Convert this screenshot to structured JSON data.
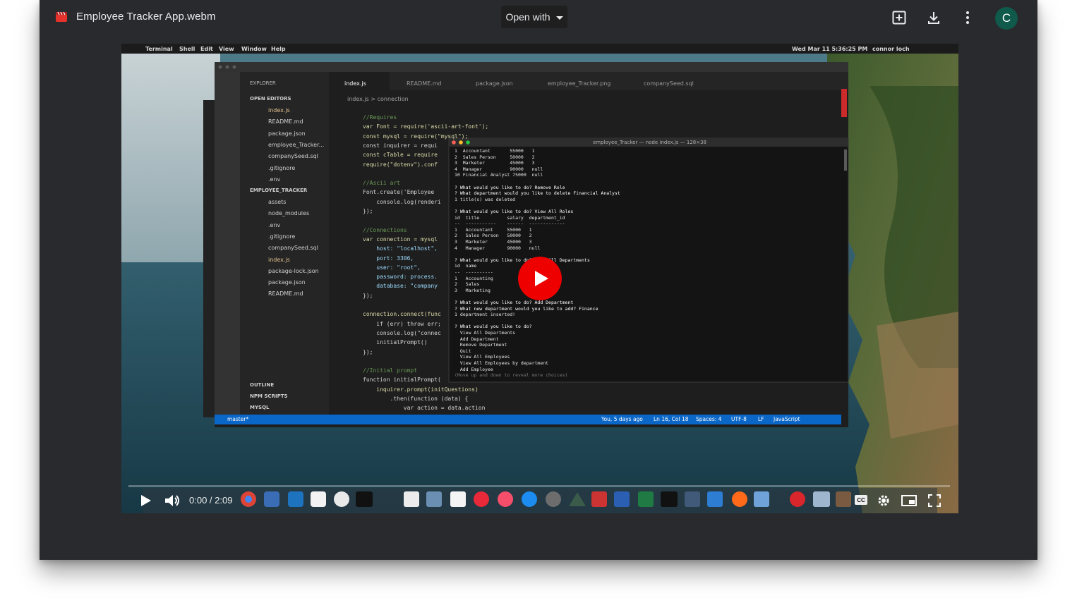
{
  "header": {
    "file_name": "Employee Tracker App.webm",
    "open_with_label": "Open with",
    "avatar_letter": "C"
  },
  "video": {
    "mac_menu": [
      "Terminal",
      "Shell",
      "Edit",
      "View",
      "Window",
      "Help"
    ],
    "clock": "Wed Mar 11 5:36:25 PM",
    "user": "connor loch",
    "editor_tabs": [
      "index.js",
      "README.md",
      "package.json",
      "employee_Tracker.png",
      "companySeed.sql"
    ],
    "breadcrumb": "index.js > connection",
    "explorer": {
      "title": "EXPLORER",
      "open_editors": "OPEN EDITORS",
      "open_files": [
        "index.js",
        "README.md",
        "package.json",
        "employee_Tracker...",
        "companySeed.sql",
        ".gitignore",
        ".env"
      ],
      "project": "EMPLOYEE_TRACKER",
      "project_files": [
        "assets",
        "node_modules",
        ".env",
        ".gitignore",
        "companySeed.sql",
        "index.js",
        "package-lock.json",
        "package.json",
        "README.md"
      ],
      "bottom_sections": [
        "OUTLINE",
        "NPM SCRIPTS",
        "MYSQL"
      ]
    },
    "code_lines": [
      "//Requires",
      "var Font = require('ascii-art-font');",
      "const mysql = require(\"mysql\");",
      "const inquirer = requi",
      "const cTable = require",
      "require(\"dotenv\").conf",
      "",
      "//Ascii art",
      "Font.create('Employee",
      "    console.log(renderi",
      "});",
      "",
      "//Connections",
      "var connection = mysql",
      "    host: \"localhost\",",
      "    port: 3306,",
      "    user: \"root\",",
      "    password: process.",
      "    database: \"company",
      "});",
      "",
      "connection.connect(func",
      "    if (err) throw err;",
      "    console.log(\"connec",
      "    initialPrompt()",
      "});",
      "",
      "//Initial prompt",
      "function initialPrompt(",
      "    inquirer.prompt(initQuestions)",
      "        .then(function (data) {",
      "            var action = data.action"
    ],
    "terminal_title": "employee_Tracker — node index.js — 128×38",
    "terminal_lines": [
      "1  Accountant       55000   1",
      "2  Sales Person     50000   2",
      "3  Marketer         45000   3",
      "4  Manager          90000   null",
      "10 Financial Analyst 75000  null",
      "",
      "? What would you like to do? Remove Role",
      "? What department would you like to delete Financial Analyst",
      "1 title(s) was deleted",
      "",
      "? What would you like to do? View All Roles",
      "id  title          salary  department_id",
      "--  -----------    ------  -------------",
      "1   Accountant     55000   1",
      "2   Sales Person   50000   2",
      "3   Marketer       45000   3",
      "4   Manager        90000   null",
      "",
      "? What would you like to do? View All Departments",
      "id  name",
      "--  ----------",
      "1   Accounting",
      "2   Sales",
      "3   Marketing",
      "",
      "? What would you like to do? Add Department",
      "? What new department would you like to add? Finance",
      "1 department inserted!",
      "",
      "? What would you like to do?",
      "  View All Departments",
      "  Add Department",
      "  Remove Department",
      "  Quit",
      "  View All Employees",
      "  View All Employees by department",
      "  Add Employee",
      "(Move up and down to reveal more choices)"
    ],
    "status_left": "master*",
    "status_right": [
      "You, 5 days ago",
      "Ln 16, Col 18",
      "Spaces: 4",
      "UTF-8",
      "LF",
      "JavaScript"
    ]
  },
  "player": {
    "current_time": "0:00",
    "duration": "2:09",
    "progress": 0,
    "cc_label": "CC"
  },
  "colors": {
    "window_bg": "#292a2d",
    "play_red": "#ee0000",
    "vscode_status": "#0a66c7",
    "avatar": "#0f5a4b"
  }
}
